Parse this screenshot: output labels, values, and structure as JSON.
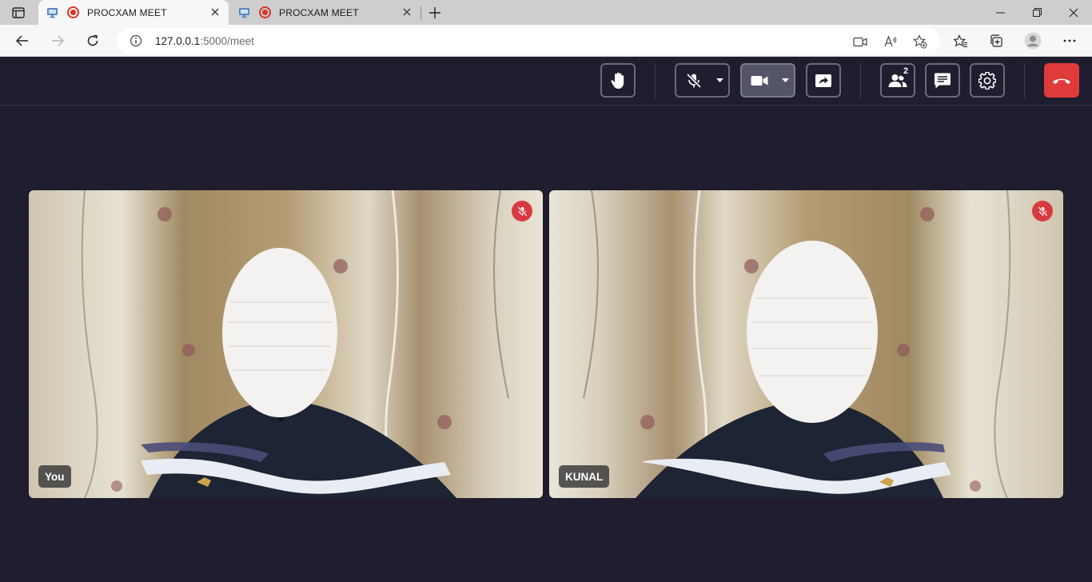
{
  "browser": {
    "tabs": [
      {
        "title": "PROCXAM MEET",
        "active": true
      },
      {
        "title": "PROCXAM MEET",
        "active": false
      }
    ],
    "address": {
      "host": "127.0.0.1",
      "path": ":5000/meet"
    }
  },
  "meeting": {
    "participants_count": "2",
    "tiles": [
      {
        "name": "You",
        "muted": true
      },
      {
        "name": "KUNAL",
        "muted": true
      }
    ],
    "controls": {
      "raise_hand": "hand-icon",
      "mic": "mic-off-icon",
      "camera": "video-camera-icon",
      "share_screen": "share-screen-icon",
      "participants": "people-icon",
      "chat": "chat-icon",
      "settings": "gear-icon",
      "leave": "hang-up-icon"
    }
  },
  "colors": {
    "background": "#1f1d2e",
    "leave_button": "#e03b3b",
    "mute_badge": "#d93a3f",
    "camera_active": "#545468"
  }
}
